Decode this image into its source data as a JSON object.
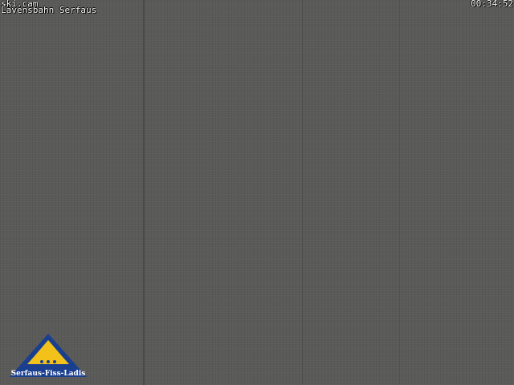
{
  "overlay": {
    "camera_name": "ski.cam",
    "location": "Lavensbahn Serfaus",
    "timestamp": "00:34:52"
  },
  "logo": {
    "brand_text": "Serfaus-Fiss-Ladis",
    "colors": {
      "navy": "#1b3f8f",
      "gold": "#f2c21b",
      "white": "#ffffff"
    }
  },
  "scene": {
    "background_color": "#5a5b58"
  }
}
